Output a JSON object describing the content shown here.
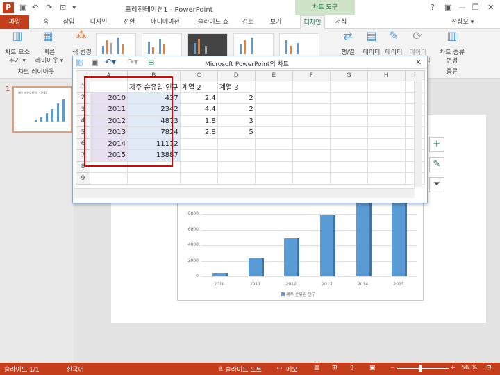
{
  "titlebar": {
    "app_icon": "P",
    "title": "프레젠테이션1 - PowerPoint",
    "chart_tools": "차트 도구",
    "help": "?",
    "minimize": "—",
    "restore": "❐",
    "close": "✕"
  },
  "tabs": {
    "file": "파일",
    "items": [
      "홈",
      "삽입",
      "디자인",
      "전환",
      "애니메이션",
      "슬라이드 쇼",
      "검토",
      "보기"
    ],
    "design": "디자인",
    "format": "서식",
    "user": "전상오 ▾"
  },
  "ribbon": {
    "add_element": "차트 요소\n추가 ▾",
    "quick_layout": "빠른\n레이아웃 ▾",
    "group_layouts": "차트 레이아웃",
    "change_colors": "색 변경",
    "switch_row_col": "행/열\n전환",
    "select_data": "데이터\n선택",
    "edit_data": "데이터\n편집",
    "refresh_data": "데이터\n새로 고침",
    "change_type": "차트 종류\n변경",
    "group_type": "종류"
  },
  "slide": {
    "number": "1",
    "thumb_title": "제주 순유입(전입 - 전출)"
  },
  "datasheet": {
    "title": "Microsoft PowerPoint의 차트",
    "close": "✕",
    "columns": [
      "",
      "A",
      "B",
      "C",
      "D",
      "E",
      "F",
      "G",
      "H",
      "I"
    ],
    "rows": [
      [
        "1",
        "",
        "제주 순유입 인구",
        "계열 2",
        "계열 3",
        "",
        "",
        "",
        "",
        ""
      ],
      [
        "2",
        "2010",
        "437",
        "2.4",
        "2",
        "",
        "",
        "",
        "",
        ""
      ],
      [
        "3",
        "2011",
        "2342",
        "4.4",
        "2",
        "",
        "",
        "",
        "",
        ""
      ],
      [
        "4",
        "2012",
        "4873",
        "1.8",
        "3",
        "",
        "",
        "",
        "",
        ""
      ],
      [
        "5",
        "2013",
        "7824",
        "2.8",
        "5",
        "",
        "",
        "",
        "",
        ""
      ],
      [
        "6",
        "2014",
        "11112",
        "",
        "",
        "",
        "",
        "",
        "",
        ""
      ],
      [
        "7",
        "2015",
        "13887",
        "",
        "",
        "",
        "",
        "",
        "",
        ""
      ],
      [
        "8",
        "",
        "",
        "",
        "",
        "",
        "",
        "",
        "",
        ""
      ],
      [
        "9",
        "",
        "",
        "",
        "",
        "",
        "",
        "",
        "",
        ""
      ]
    ]
  },
  "chart_data": {
    "type": "bar",
    "categories": [
      "2010",
      "2011",
      "2012",
      "2013",
      "2014",
      "2015"
    ],
    "series": [
      {
        "name": "제주 순유입 인구",
        "values": [
          437,
          2342,
          4873,
          7824,
          11112,
          13887
        ]
      }
    ],
    "yticks": [
      "0",
      "2000",
      "4000",
      "6000",
      "8000"
    ],
    "ylim": [
      0,
      8000
    ],
    "legend_position": "bottom",
    "colors": {
      "bar": "#5b9bd5",
      "bar_side": "#3f74a8"
    }
  },
  "statusbar": {
    "slide": "슬라이드 1/1",
    "language": "한국어",
    "notes": "≜ 슬라이드 노트",
    "comments": "메모",
    "zoom": "56 %",
    "minus": "−",
    "plus": "+"
  }
}
